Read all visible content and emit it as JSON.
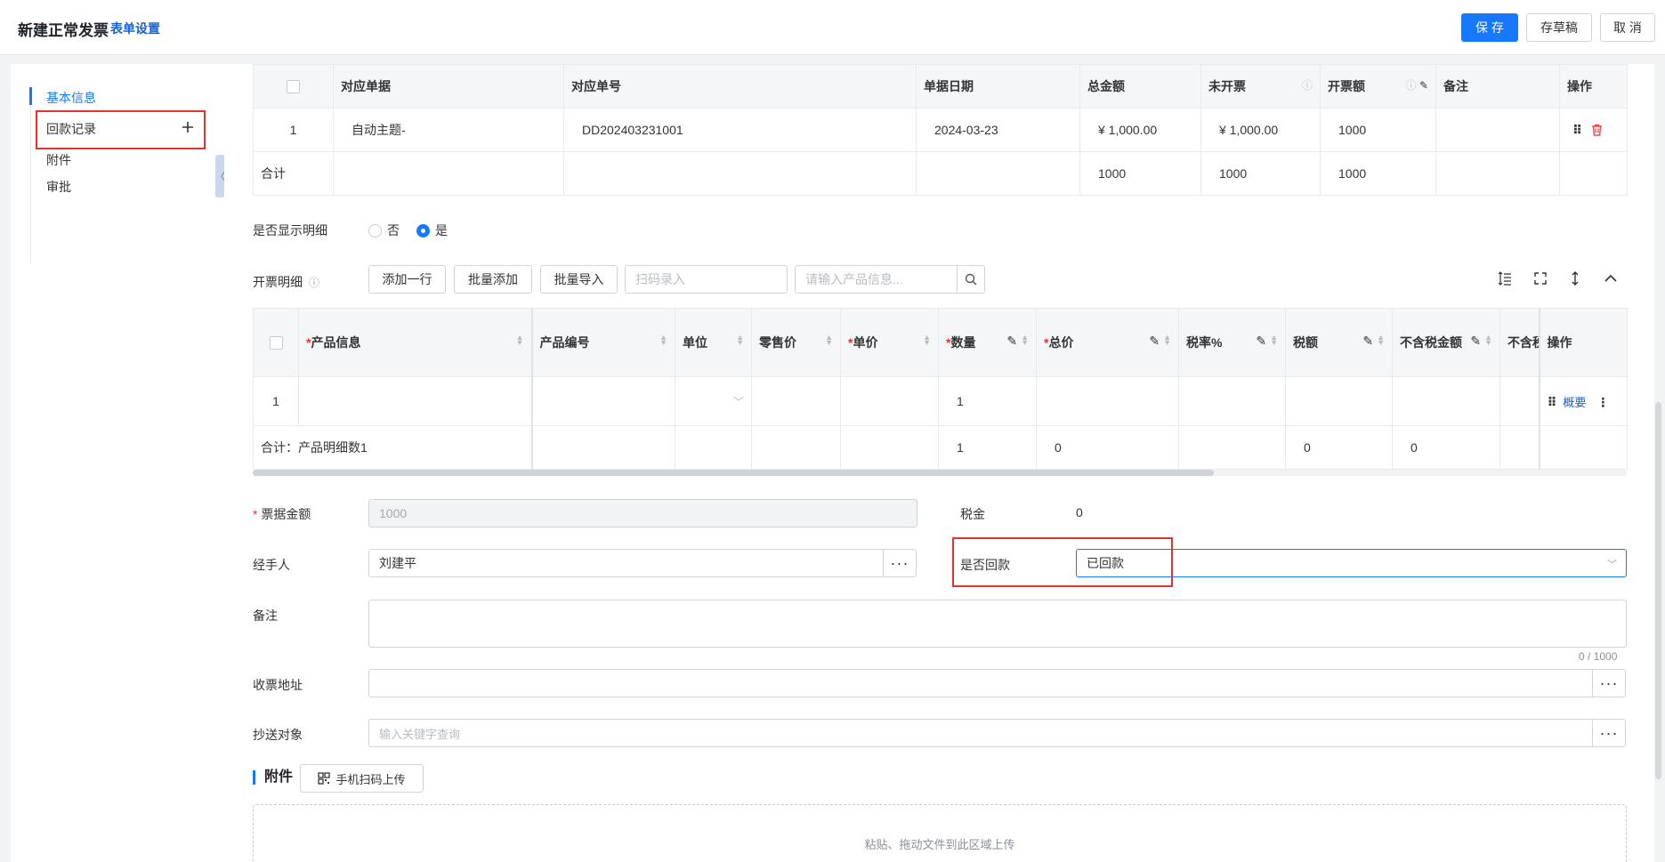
{
  "header": {
    "title": "新建正常发票",
    "form_settings": "表单设置",
    "save": "保 存",
    "draft": "存草稿",
    "cancel": "取 消"
  },
  "sidebar": {
    "items": [
      {
        "label": "基本信息",
        "active": true
      },
      {
        "label": "回款记录"
      },
      {
        "label": "附件"
      },
      {
        "label": "审批"
      }
    ],
    "add_icon": "plus-icon",
    "collapse_icon": "chevron-left-icon"
  },
  "source_table": {
    "headers": [
      "对应单据",
      "对应单号",
      "单据日期",
      "总金额",
      "未开票",
      "开票额",
      "备注",
      "操作"
    ],
    "rows": [
      {
        "index": "1",
        "doc": "自动主题-",
        "number": "DD202403231001",
        "date": "2024-03-23",
        "total": "¥ 1,000.00",
        "unbilled": "¥ 1,000.00",
        "billed": "1000",
        "remark": ""
      }
    ],
    "sum_row": {
      "label": "合计",
      "total": "1000",
      "unbilled": "1000",
      "billed": "1000"
    }
  },
  "show_detail": {
    "label": "是否显示明细",
    "options": [
      "否",
      "是"
    ],
    "selected": "是"
  },
  "detail_toolbar": {
    "label": "开票明细",
    "add_row": "添加一行",
    "batch_add": "批量添加",
    "batch_import": "批量导入",
    "scan_placeholder": "扫码录入",
    "search_placeholder": "请输入产品信息..."
  },
  "detail_table": {
    "headers": [
      "产品信息",
      "产品编号",
      "单位",
      "零售价",
      "单价",
      "数量",
      "总价",
      "税率%",
      "税额",
      "不含税金额",
      "不含税",
      "操作"
    ],
    "rows": [
      {
        "index": "1",
        "quantity": "1",
        "action_link": "概要"
      }
    ],
    "sum_row": {
      "label": "合计：产品明细数1",
      "quantity": "1",
      "total": "0",
      "tax": "0",
      "excl": "0"
    }
  },
  "form": {
    "amount_label": "票据金额",
    "amount_value": "1000",
    "tax_label": "税金",
    "tax_value": "0",
    "handler_label": "经手人",
    "handler_value": "刘建平",
    "refund_label": "是否回款",
    "refund_value": "已回款",
    "remark_label": "备注",
    "remark_counter": "0 / 1000",
    "address_label": "收票地址",
    "cc_label": "抄送对象",
    "cc_placeholder": "输入关键字查询"
  },
  "attachment": {
    "title": "附件",
    "mobile_upload": "手机扫码上传",
    "drop_text": "粘贴、拖动文件到此区域上传"
  },
  "colors": {
    "primary": "#1677ff",
    "link": "#1663d6",
    "highlight": "#e7312f",
    "danger": "#e7312f"
  }
}
